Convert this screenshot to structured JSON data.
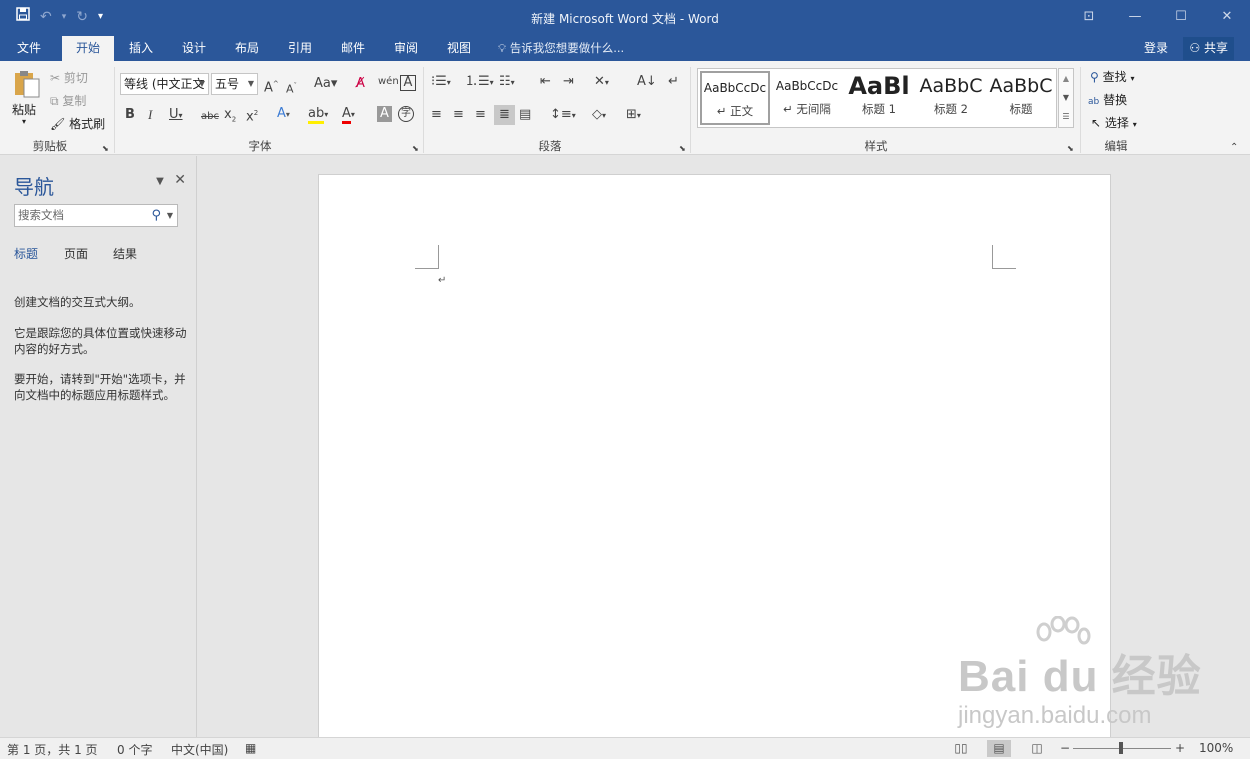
{
  "window": {
    "title": "新建 Microsoft Word 文档 - Word",
    "qat": {
      "save_icon": "save-icon",
      "undo_icon": "undo-icon",
      "redo_icon": "redo-icon",
      "more": "▾"
    },
    "controls": {
      "ribbon_display": "⊡",
      "minimize": "—",
      "maximize": "☐",
      "close": "✕"
    }
  },
  "tabs": {
    "items": [
      "文件",
      "开始",
      "插入",
      "设计",
      "布局",
      "引用",
      "邮件",
      "审阅",
      "视图"
    ],
    "active": "开始",
    "tell_me": "告诉我您想要做什么...",
    "login": "登录",
    "share": "共享"
  },
  "ribbon": {
    "clipboard": {
      "paste": "粘贴",
      "cut": "剪切",
      "copy": "复制",
      "format_painter": "格式刷",
      "label": "剪贴板"
    },
    "font": {
      "name": "等线 (中文正文",
      "size": "五号",
      "label": "字体"
    },
    "paragraph": {
      "label": "段落"
    },
    "styles": {
      "label": "样式",
      "items": [
        {
          "sample": "AaBbCcDc",
          "name": "↵ 正文"
        },
        {
          "sample": "AaBbCcDc",
          "name": "↵ 无间隔"
        },
        {
          "sample": "AaBl",
          "name": "标题 1"
        },
        {
          "sample": "AaBbC",
          "name": "标题 2"
        },
        {
          "sample": "AaBbC",
          "name": "标题"
        }
      ]
    },
    "editing": {
      "find": "查找",
      "replace": "替换",
      "select": "选择",
      "label": "编辑"
    }
  },
  "nav": {
    "title": "导航",
    "search_placeholder": "搜索文档",
    "tabs": [
      "标题",
      "页面",
      "结果"
    ],
    "active_tab": "标题",
    "text1": "创建文档的交互式大纲。",
    "text2": "它是跟踪您的具体位置或快速移动内容的好方式。",
    "text3": "要开始，请转到\"开始\"选项卡，并向文档中的标题应用标题样式。"
  },
  "document": {
    "paragraph_mark": "↵"
  },
  "watermark": {
    "brand": "Bai du 经验",
    "site": "jingyan.baidu.com"
  },
  "status": {
    "page": "第 1 页，共 1 页",
    "words": "0 个字",
    "language": "中文(中国)",
    "zoom": "100%",
    "zoom_minus": "−",
    "zoom_plus": "+"
  }
}
